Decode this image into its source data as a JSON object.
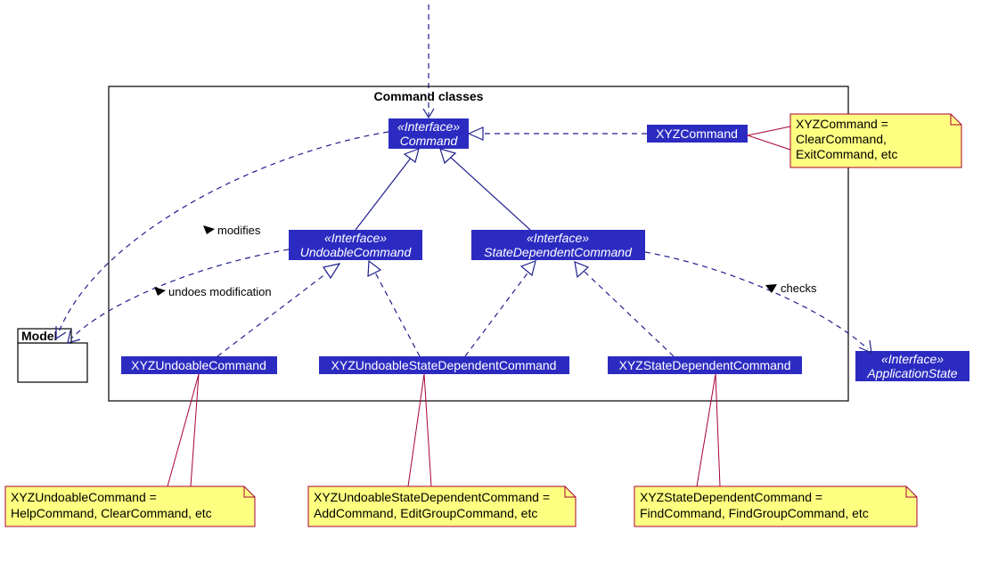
{
  "diagram": {
    "package_label": "Command classes",
    "model_label": "Model",
    "stereotype": "«Interface»",
    "classes": {
      "command": "Command",
      "undoable": "UndoableCommand",
      "statedep": "StateDependentCommand",
      "appstate": "ApplicationState",
      "xyz_cmd": "XYZCommand",
      "xyz_undoable": "XYZUndoableCommand",
      "xyz_undo_state": "XYZUndoableStateDependentCommand",
      "xyz_state": "XYZStateDependentCommand"
    },
    "edge_labels": {
      "modifies": "modifies",
      "undoes": "undoes modification",
      "checks": "checks"
    },
    "notes": {
      "xyz_cmd": [
        "XYZCommand =",
        "ClearCommand,",
        "ExitCommand, etc"
      ],
      "xyz_undoable": [
        "XYZUndoableCommand =",
        "HelpCommand, ClearCommand, etc"
      ],
      "xyz_undo_state": [
        "XYZUndoableStateDependentCommand =",
        "AddCommand, EditGroupCommand, etc"
      ],
      "xyz_state": [
        "XYZStateDependentCommand =",
        "FindCommand, FindGroupCommand, etc"
      ]
    }
  }
}
